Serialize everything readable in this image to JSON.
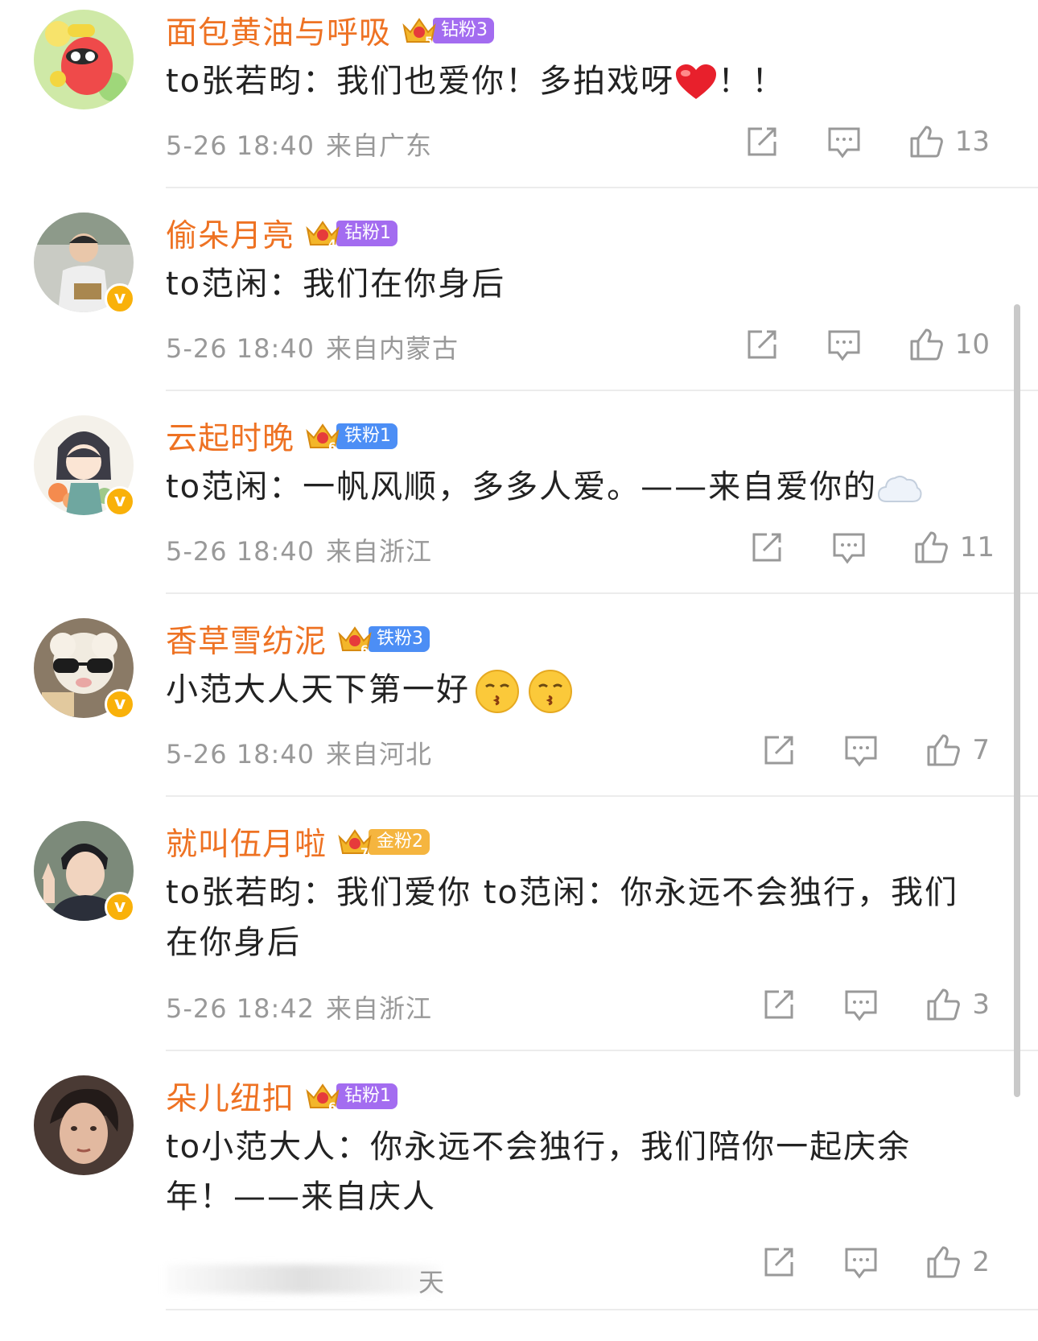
{
  "comments": [
    {
      "username": "面包黄油与呼吸",
      "badge": {
        "label": "钻粉3",
        "level": "5",
        "color": "#a36cf0"
      },
      "verified": false,
      "text": "to张若昀：我们也爱你！多拍戏呀",
      "text_suffix": "！！",
      "emoji": "heart-emoji",
      "time": "5-26 18:40",
      "location": "来自广东",
      "likes": "13"
    },
    {
      "username": "偷朵月亮",
      "badge": {
        "label": "钻粉1",
        "level": "4",
        "color": "#a36cf0"
      },
      "verified": true,
      "text": "to范闲：我们在你身后",
      "time": "5-26 18:40",
      "location": "来自内蒙古",
      "likes": "10"
    },
    {
      "username": "云起时晚",
      "badge": {
        "label": "铁粉1",
        "level": "6",
        "color": "#4c8ef5"
      },
      "verified": true,
      "text": "to范闲：一帆风顺，多多人爱。——来自爱你的",
      "emoji": "cloud-emoji",
      "time": "5-26 18:40",
      "location": "来自浙江",
      "likes": "11"
    },
    {
      "username": "香草雪纺泥",
      "badge": {
        "label": "铁粉3",
        "level": "6",
        "color": "#4c8ef5"
      },
      "verified": true,
      "text": "小范大人天下第一好",
      "emoji": "kiss-emoji",
      "time": "5-26 18:40",
      "location": "来自河北",
      "likes": "7"
    },
    {
      "username": "就叫伍月啦",
      "badge": {
        "label": "金粉2",
        "level": "7",
        "color": "#f5b53f"
      },
      "verified": true,
      "text": "to张若昀：我们爱你 to范闲：你永远不会独行，我们在你身后",
      "time": "5-26 18:42",
      "location": "来自浙江",
      "likes": "3"
    },
    {
      "username": "朵儿纽扣",
      "badge": {
        "label": "钻粉1",
        "level": "6",
        "color": "#a36cf0"
      },
      "verified": false,
      "text": "to小范大人：你永远不会独行，我们陪你一起庆余年！——来自庆人",
      "time_blurred_tail": "天",
      "likes": "2"
    }
  ],
  "icons": {
    "share": "share-icon",
    "reply": "reply-icon",
    "like": "like-icon"
  },
  "colors": {
    "username": "#ee7223",
    "meta": "#999999",
    "text": "#222222",
    "verified": "#f9b10a"
  }
}
